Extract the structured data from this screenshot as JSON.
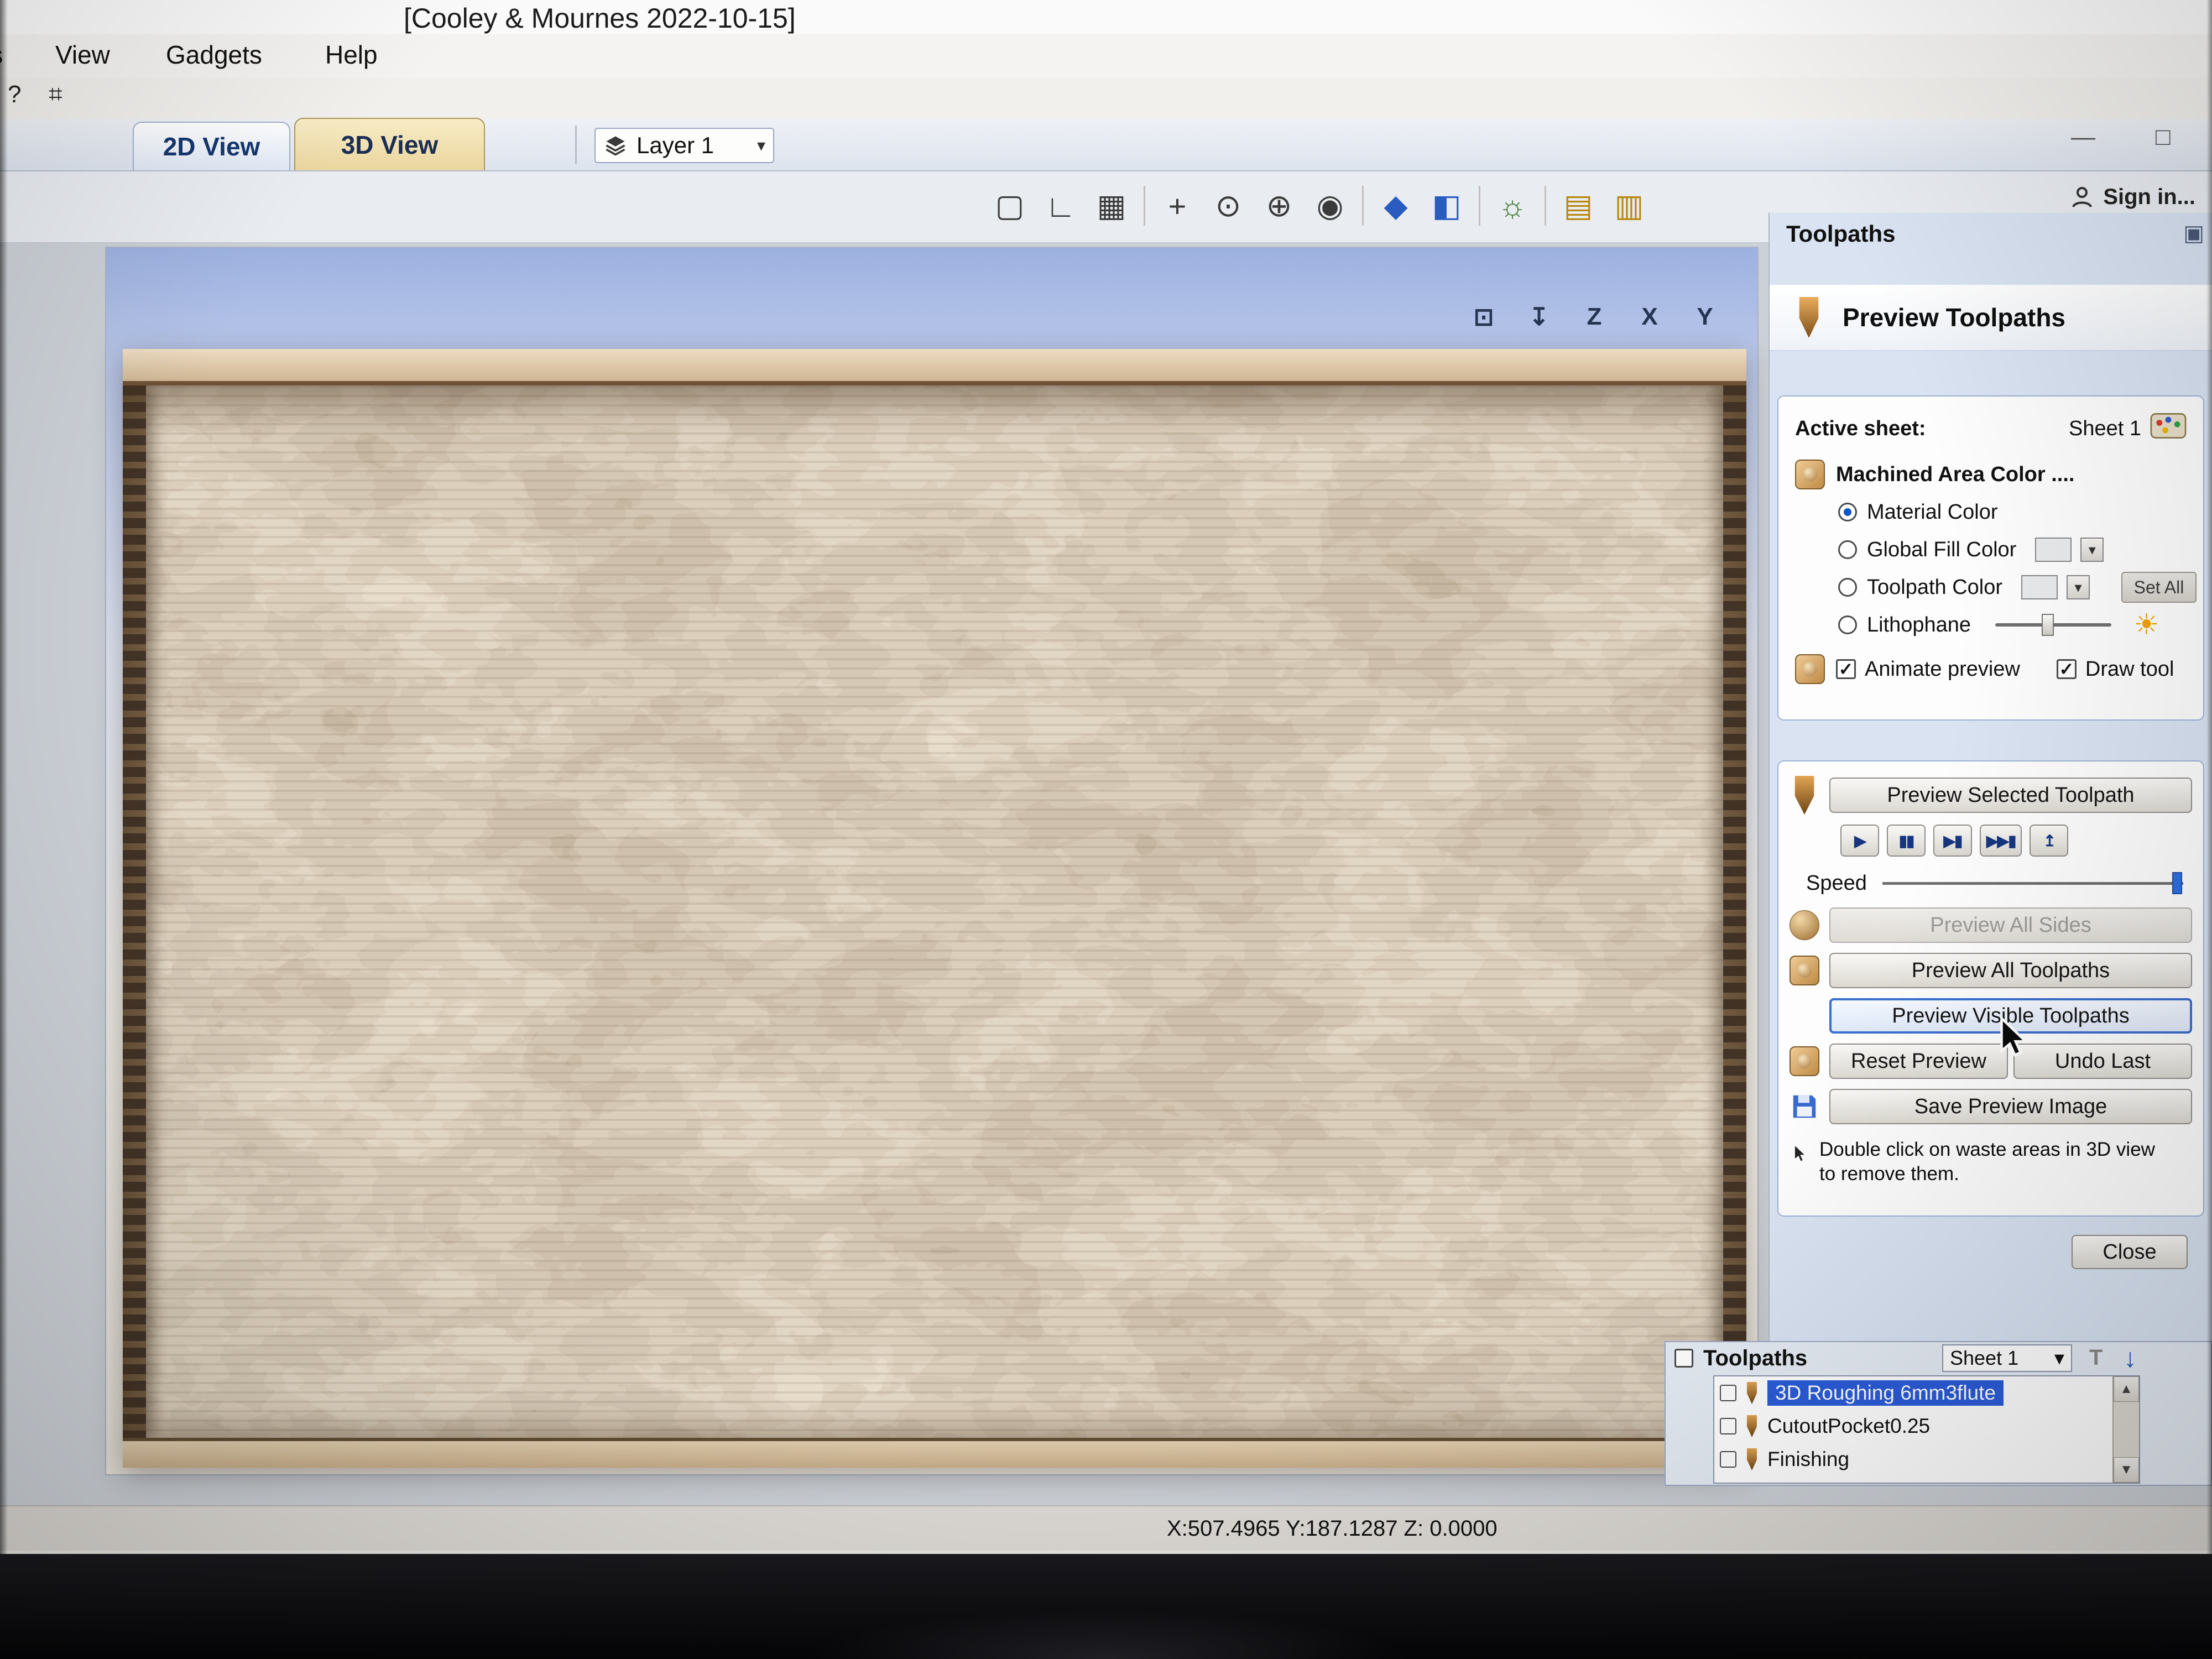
{
  "window": {
    "title": "[Cooley & Mournes 2022-10-15]",
    "minimize_glyph": "—",
    "maximize_glyph": "□",
    "sign_in": "Sign in..."
  },
  "menu": {
    "partial": "s",
    "items": [
      "View",
      "Gadgets",
      "Help"
    ],
    "help_glyph": "?",
    "pin_glyph": "⌗"
  },
  "view_tabs": {
    "tab_2d": "2D View",
    "tab_3d": "3D View"
  },
  "layer_selector": {
    "label": "Layer 1",
    "caret": "▾"
  },
  "toolbar": {
    "icons": [
      {
        "name": "fit-to-window-icon",
        "glyph": "▢"
      },
      {
        "name": "snap-settings-icon",
        "glyph": "∟"
      },
      {
        "name": "grid-toggle-icon",
        "glyph": "▦"
      },
      {
        "name": "pan-view-icon",
        "glyph": "+"
      },
      {
        "name": "zoom-window-icon",
        "glyph": "⊙"
      },
      {
        "name": "zoom-in-icon",
        "glyph": "⊕"
      },
      {
        "name": "zoom-selected-icon",
        "glyph": "◉"
      },
      {
        "name": "rotate-view-icon",
        "glyph": "◆"
      },
      {
        "name": "shading-mode-icon",
        "glyph": "◧"
      },
      {
        "name": "lighting-icon",
        "glyph": "☼"
      },
      {
        "name": "sheet-layers-icon",
        "glyph": "▤"
      },
      {
        "name": "view-settings-icon",
        "glyph": "▥"
      }
    ]
  },
  "view_controls": [
    {
      "name": "iso-view-icon",
      "glyph": "⊡"
    },
    {
      "name": "look-down-icon",
      "glyph": "↧"
    },
    {
      "name": "z-axis-view-icon",
      "glyph": "Z"
    },
    {
      "name": "x-axis-view-icon",
      "glyph": "X"
    },
    {
      "name": "y-axis-view-icon",
      "glyph": "Y"
    }
  ],
  "preview_panel": {
    "title": "Toolpaths",
    "options_glyph": "▣",
    "header": "Preview Toolpaths",
    "active_sheet_label": "Active sheet:",
    "active_sheet_value": "Sheet 1",
    "machined_color_label": "Machined Area Color ....",
    "radio_material": "Material Color",
    "radio_global": "Global Fill Color",
    "radio_toolpath": "Toolpath Color",
    "radio_lithophane": "Lithophane",
    "set_all": "Set All",
    "sun_glyph": "☀",
    "chk_animate": "Animate preview",
    "chk_draw_tool": "Draw tool",
    "btn_preview_selected": "Preview Selected Toolpath",
    "playback": [
      {
        "name": "play-button",
        "glyph": "▶"
      },
      {
        "name": "pause-button",
        "glyph": "▮▮"
      },
      {
        "name": "single-step-button",
        "glyph": "▶▮"
      },
      {
        "name": "fast-forward-button",
        "glyph": "▶▶▮"
      },
      {
        "name": "run-to-end-button",
        "glyph": "↥"
      }
    ],
    "speed_label": "Speed",
    "btn_all_sides": "Preview All Sides",
    "btn_all_toolpaths": "Preview All Toolpaths",
    "btn_visible_toolpaths": "Preview Visible Toolpaths",
    "btn_reset": "Reset Preview",
    "btn_undo": "Undo Last",
    "btn_save_image": "Save Preview Image",
    "hint_line1": "Double click on waste areas in 3D view",
    "hint_line2": "to remove them.",
    "btn_close": "Close"
  },
  "toolpath_tree": {
    "header": "Toolpaths",
    "sheet": "Sheet 1",
    "template_glyph": "T",
    "movedown_glyph": "↓",
    "items": [
      {
        "label": "3D Roughing 6mm3flute",
        "selected": true
      },
      {
        "label": "CutoutPocket0.25",
        "selected": false
      },
      {
        "label": "Finishing",
        "selected": false
      }
    ]
  },
  "status_bar": {
    "coords": "X:507.4965 Y:187.1287 Z:  0.0000"
  },
  "glyphs": {
    "caret": "▾",
    "scroll_up": "▲",
    "scroll_down": "▼"
  },
  "colors": {
    "selection_blue": "#2b5cd9",
    "material_beige": "#e4d4bf",
    "active_tab_tan": "#ead59e"
  }
}
